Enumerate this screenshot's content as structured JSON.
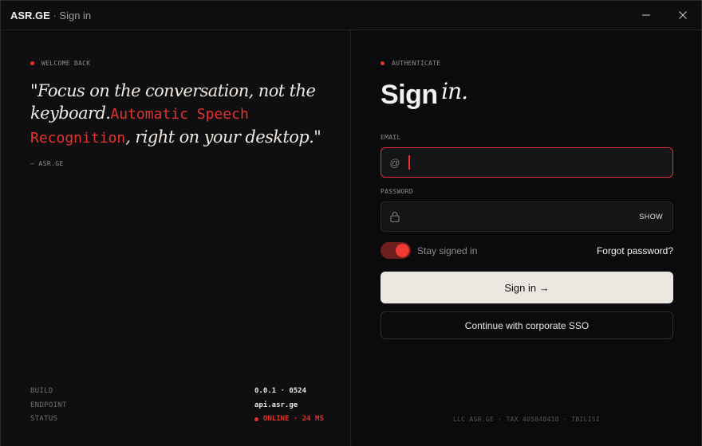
{
  "window": {
    "app_name": "ASR.GE",
    "separator": " · ",
    "subtitle": "Sign in",
    "minimize_icon": "minimize-icon",
    "close_icon": "close-icon"
  },
  "left": {
    "eyebrow": "WELCOME BACK",
    "quote_part1": "\"Focus on the conversation, not the keyboard.",
    "quote_highlight": "Automatic Speech Recognition",
    "quote_part2": ", right on your desktop.\"",
    "attribution": "— ASR.GE",
    "meta": [
      {
        "key": "BUILD",
        "value": "0.0.1 · 0524"
      },
      {
        "key": "ENDPOINT",
        "value": "api.asr.ge"
      },
      {
        "key": "STATUS",
        "value": "ONLINE · 24 MS"
      }
    ]
  },
  "right": {
    "eyebrow": "AUTHENTICATE",
    "heading_main": "Sign",
    "heading_accent": "in.",
    "email": {
      "label": "EMAIL",
      "prefix": "@",
      "value": "",
      "placeholder": ""
    },
    "password": {
      "label": "PASSWORD",
      "value": "",
      "placeholder": "",
      "show_label": "SHOW"
    },
    "stay_signed_in": {
      "label": "Stay signed in",
      "checked": true
    },
    "forgot_label": "Forgot password?",
    "sign_in_label": "Sign in →",
    "sso_label": "Continue with corporate SSO",
    "footer": "LLC ASR.GE · TAX 405848418 · TBILISI"
  },
  "colors": {
    "accent": "#e5322d",
    "background": "#0e0e10",
    "primary_button": "#ece8e1"
  }
}
